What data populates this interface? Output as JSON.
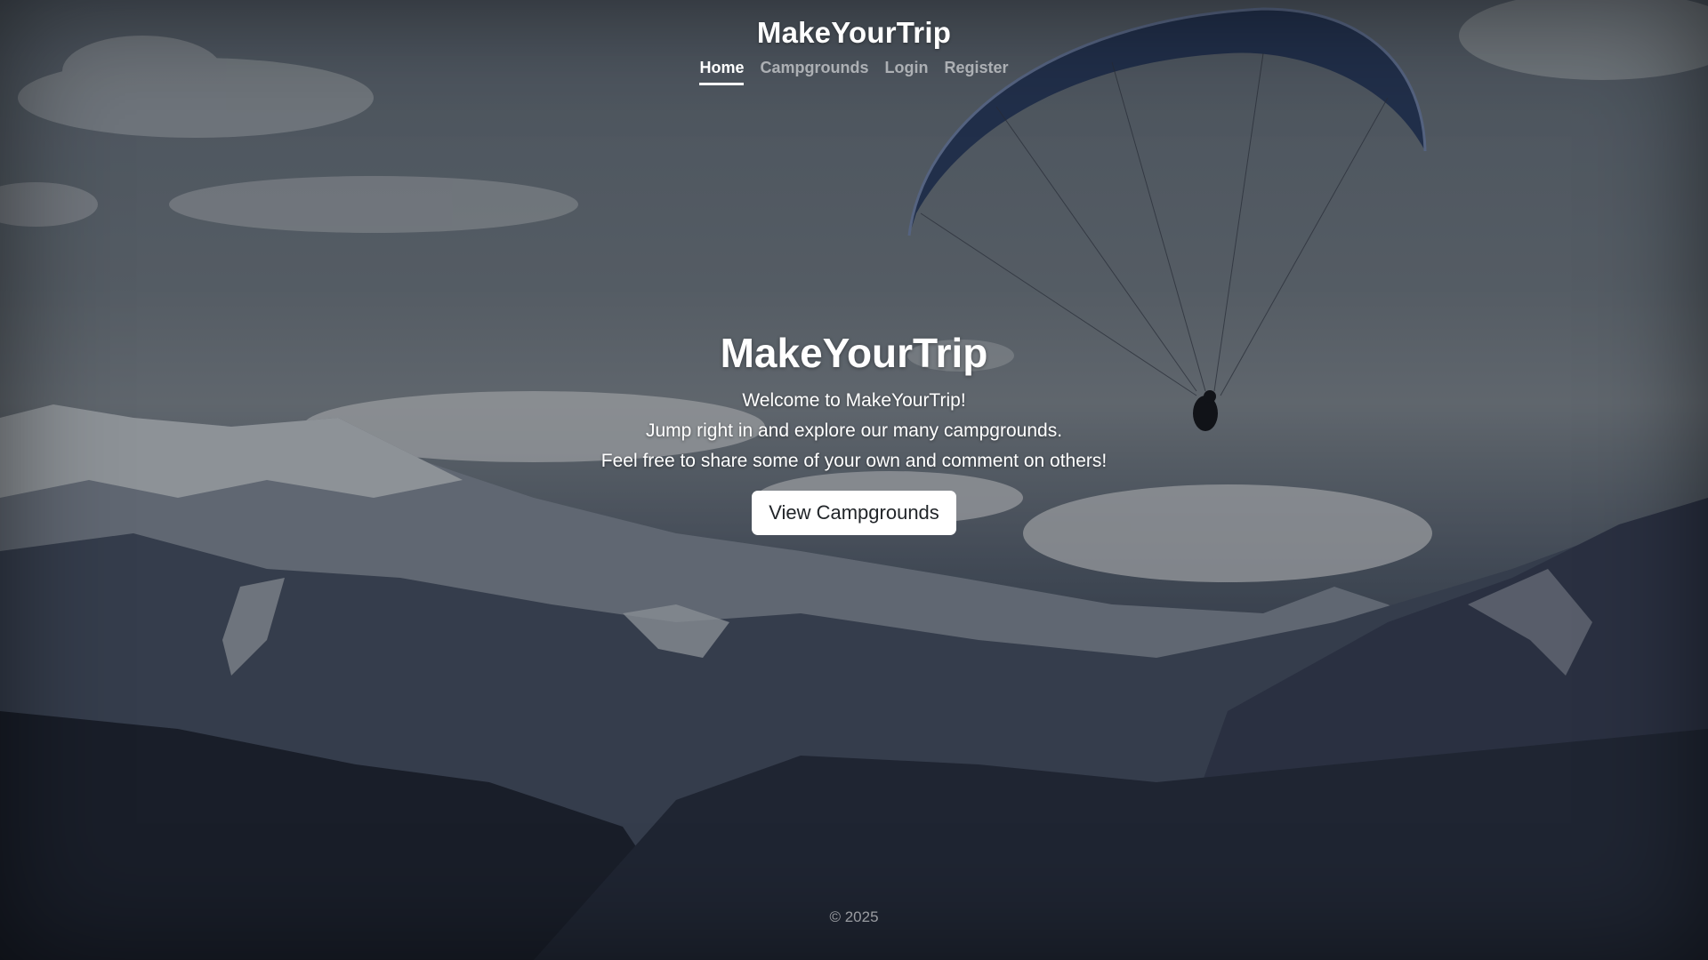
{
  "header": {
    "brand": "MakeYourTrip",
    "nav": [
      {
        "label": "Home",
        "active": true
      },
      {
        "label": "Campgrounds",
        "active": false
      },
      {
        "label": "Login",
        "active": false
      },
      {
        "label": "Register",
        "active": false
      }
    ]
  },
  "hero": {
    "title": "MakeYourTrip",
    "lines": [
      "Welcome to MakeYourTrip!",
      "Jump right in and explore our many campgrounds.",
      "Feel free to share some of your own and comment on others!"
    ],
    "cta_label": "View Campgrounds"
  },
  "footer": {
    "copyright": "© 2025"
  },
  "colors": {
    "overlay": "#000000",
    "button_bg": "#ffffff",
    "button_text": "#212529"
  }
}
